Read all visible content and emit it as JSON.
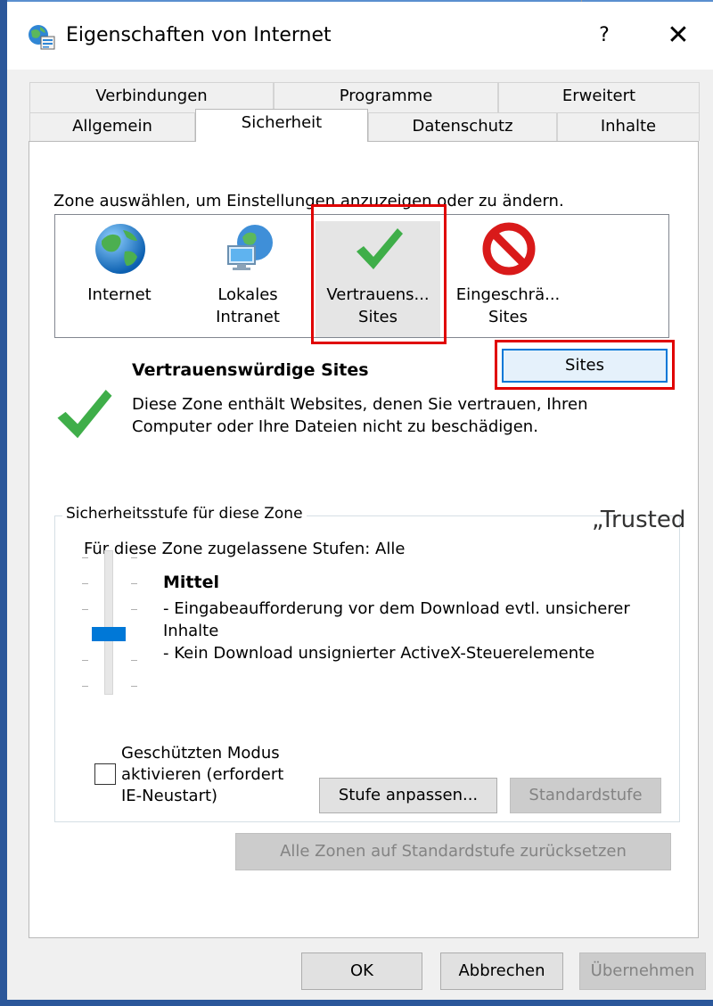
{
  "window": {
    "title": "Eigenschaften von Internet",
    "help_glyph": "?",
    "close_glyph": "✕"
  },
  "tabs": {
    "row1": [
      {
        "label": "Verbindungen"
      },
      {
        "label": "Programme"
      },
      {
        "label": "Erweitert"
      }
    ],
    "row2": [
      {
        "label": "Allgemein"
      },
      {
        "label": "Sicherheit",
        "active": true
      },
      {
        "label": "Datenschutz"
      },
      {
        "label": "Inhalte"
      }
    ]
  },
  "security": {
    "zone_prompt": "Zone auswählen, um Einstellungen anzuzeigen oder zu ändern.",
    "zones": [
      {
        "line1": "Internet",
        "line2": "",
        "icon": "globe-icon"
      },
      {
        "line1": "Lokales",
        "line2": "Intranet",
        "icon": "intranet-icon"
      },
      {
        "line1": "Vertrauens...",
        "line2": "Sites",
        "icon": "checkmark-icon",
        "selected": true
      },
      {
        "line1": "Eingeschrä...",
        "line2": "Sites",
        "icon": "restricted-icon"
      }
    ],
    "sites_button": "Sites",
    "selected_zone_title": "Vertrauenswürdige Sites",
    "selected_zone_desc": "Diese Zone enthält Websites, denen Sie vertrauen, Ihren Computer oder Ihre Dateien nicht zu beschädigen.",
    "level_group": {
      "legend": "Sicherheitsstufe für diese Zone",
      "allowed": "Für diese Zone zugelassene Stufen: Alle",
      "level_name": "Mittel",
      "desc_line1": "- Eingabeaufforderung vor dem Download evtl. unsicherer Inhalte",
      "desc_line2": "- Kein Download unsignierter ActiveX-Steuerelemente",
      "protected_mode_label": "Geschützten Modus aktivieren (erfordert IE-Neustart)",
      "protected_mode_checked": false,
      "custom_level_button": "Stufe anpassen...",
      "default_level_button": "Standardstufe"
    },
    "reset_all_button": "Alle Zonen auf Standardstufe zurücksetzen"
  },
  "footer": {
    "ok": "OK",
    "cancel": "Abbrechen",
    "apply": "Übernehmen"
  },
  "overlay_text": "„Trusted",
  "colors": {
    "accent": "#0078d7",
    "highlight_frame": "#e00000",
    "window_border": "#2b579a"
  }
}
